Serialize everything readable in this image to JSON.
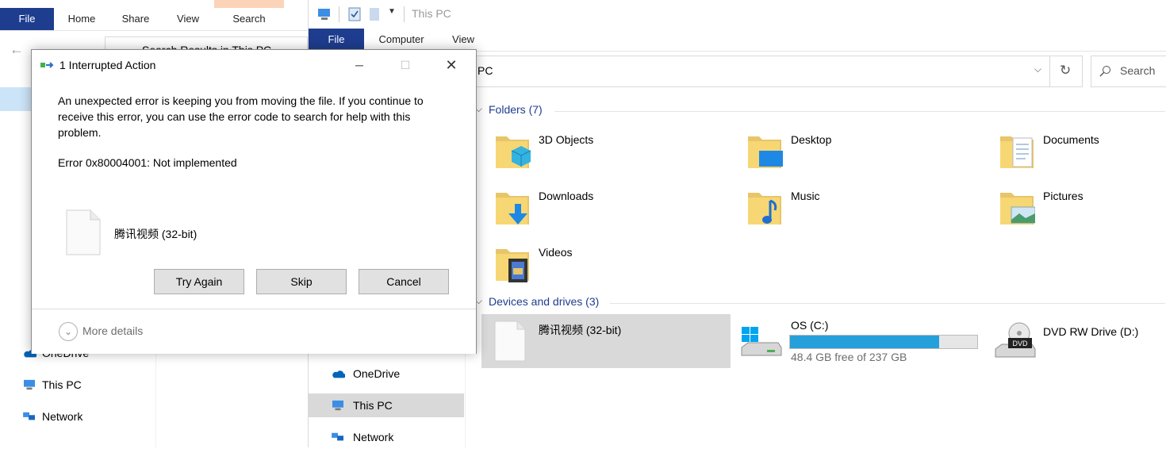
{
  "left_window": {
    "tabs": [
      "File",
      "Home",
      "Share",
      "View",
      "Search"
    ],
    "address": "Search Results in This PC",
    "nav": [
      {
        "label": "OneDrive",
        "icon": "onedrive-icon"
      },
      {
        "label": "This PC",
        "icon": "computer-icon"
      },
      {
        "label": "Network",
        "icon": "network-icon"
      }
    ]
  },
  "right_window": {
    "title": "This PC",
    "tabs": [
      "File",
      "Computer",
      "View"
    ],
    "address": "PC",
    "search_placeholder": "Search",
    "nav": [
      {
        "label": "OneDrive",
        "icon": "onedrive-icon"
      },
      {
        "label": "This PC",
        "icon": "computer-icon"
      },
      {
        "label": "Network",
        "icon": "network-icon"
      }
    ],
    "folders_header": "Folders (7)",
    "folders": [
      {
        "label": "3D Objects",
        "icon": "3d-objects-folder-icon"
      },
      {
        "label": "Desktop",
        "icon": "desktop-folder-icon"
      },
      {
        "label": "Documents",
        "icon": "documents-folder-icon"
      },
      {
        "label": "Downloads",
        "icon": "downloads-folder-icon"
      },
      {
        "label": "Music",
        "icon": "music-folder-icon"
      },
      {
        "label": "Pictures",
        "icon": "pictures-folder-icon"
      },
      {
        "label": "Videos",
        "icon": "videos-folder-icon"
      }
    ],
    "drives_header": "Devices and drives (3)",
    "drives": [
      {
        "label": "腾讯视频 (32-bit)",
        "icon": "file-icon"
      },
      {
        "label": "OS (C:)",
        "icon": "windows-drive-icon",
        "free_text": "48.4 GB free of 237 GB",
        "used_fraction": 0.796
      },
      {
        "label": "DVD RW Drive (D:)",
        "icon": "dvd-drive-icon"
      }
    ]
  },
  "dialog": {
    "title": "1 Interrupted Action",
    "message": "An unexpected error is keeping you from moving the file. If you continue to receive this error, you can use the error code to search for help with this problem.",
    "error": "Error 0x80004001: Not implemented",
    "file_name": "腾讯视频 (32-bit)",
    "buttons": {
      "try_again": "Try Again",
      "skip": "Skip",
      "cancel": "Cancel"
    },
    "more_details": "More details"
  },
  "colors": {
    "accent": "#1e3d8f",
    "drive_fill": "#26a0da",
    "selection": "#d9d9d9"
  }
}
